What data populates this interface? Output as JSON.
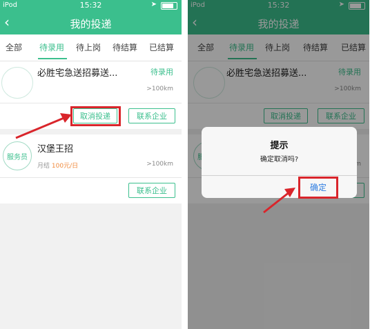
{
  "status_bar": {
    "carrier": "iPod",
    "time": "15:32"
  },
  "navbar": {
    "back_glyph": "‹",
    "title": "我的投递"
  },
  "tabs": [
    {
      "label": "全部"
    },
    {
      "label": "待录用"
    },
    {
      "label": "待上岗"
    },
    {
      "label": "待结算"
    },
    {
      "label": "已结算"
    }
  ],
  "active_tab_index": 1,
  "job_1": {
    "title": "必胜宅急送招募送...",
    "status": "待录用",
    "distance": ">100km",
    "cancel_button": "取消投递",
    "contact_button": "联系企业"
  },
  "job_2": {
    "avatar_label": "服务员",
    "title": "汉堡王招",
    "pay_period": "月结",
    "pay_amount": "100元/日",
    "distance": ">100km",
    "contact_button": "联系企业"
  },
  "dialog": {
    "title": "提示",
    "message": "确定取消吗?",
    "confirm_button": "确定"
  },
  "colors": {
    "brand": "#3bbf8d",
    "highlight": "#d9252b",
    "salary": "#f08a3c",
    "dialog_confirm": "#2f7de1"
  },
  "icons": [
    "back-chevron-icon",
    "battery-icon",
    "location-arrow-icon",
    "annotation-arrow-icon"
  ]
}
